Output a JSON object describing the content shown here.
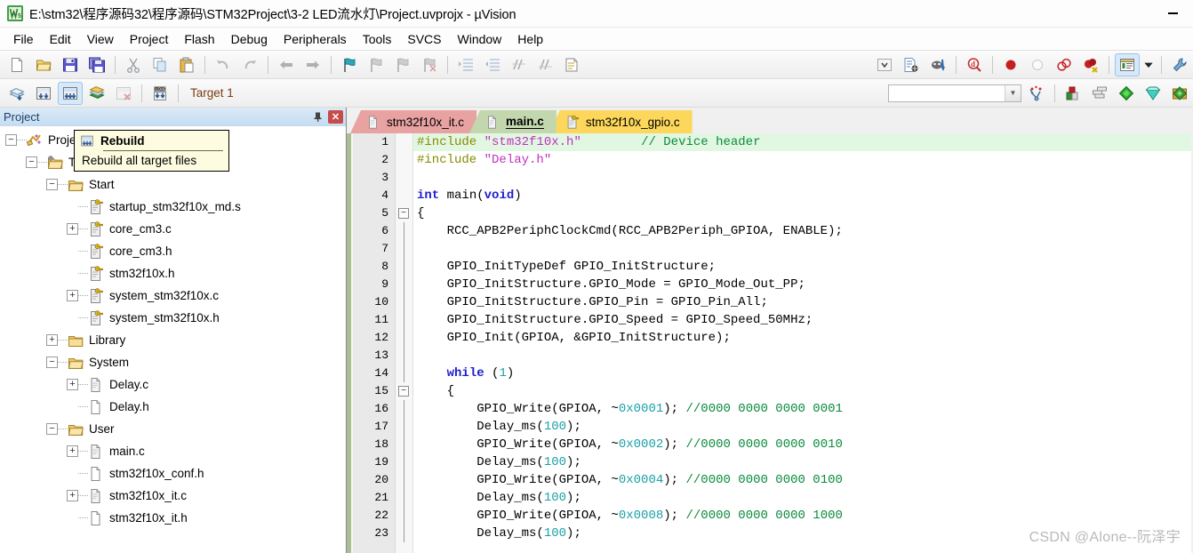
{
  "window": {
    "title": "E:\\stm32\\程序源码32\\程序源码\\STM32Project\\3-2 LED流水灯\\Project.uvprojx - µVision",
    "logo_text": "µV",
    "minimize_label": "—"
  },
  "menu": {
    "items": [
      "File",
      "Edit",
      "View",
      "Project",
      "Flash",
      "Debug",
      "Peripherals",
      "Tools",
      "SVCS",
      "Window",
      "Help"
    ]
  },
  "toolbar_main": {
    "icons": [
      "new-file-icon",
      "open-file-icon",
      "save-icon",
      "save-all-icon",
      "cut-icon",
      "copy-icon",
      "paste-icon",
      "undo-icon",
      "redo-icon",
      "navigate-back-icon",
      "navigate-forward-icon",
      "bookmark-toggle-icon",
      "bookmark-prev-icon",
      "bookmark-next-icon",
      "bookmark-clear-icon",
      "indent-icon",
      "outdent-icon",
      "comment-icon",
      "uncomment-icon",
      "find-in-files-icon"
    ],
    "right_icons": [
      "combo-arrow-icon",
      "configure-icon",
      "debug-settings-icon",
      "find-icon",
      "breakpoint-icon",
      "breakpoint-disable-icon",
      "breakpoint-disable-all-icon",
      "breakpoint-kill-all-icon",
      "project-window-icon",
      "dropdown-arrow-icon",
      "configure-target-icon"
    ]
  },
  "toolbar_build": {
    "icons": [
      "translate-icon",
      "build-icon",
      "rebuild-icon",
      "batch-build-icon",
      "stop-build-icon",
      "download-icon"
    ],
    "target_value": "Target 1",
    "right_icons": [
      "manage-project-items-icon",
      "multi-project-icon",
      "start-debug-icon",
      "insert-icon",
      "manage-components-icon"
    ]
  },
  "project_panel": {
    "title": "Project",
    "pin_icon": "pin-icon",
    "close_label": "✕",
    "tree": [
      {
        "level": 0,
        "expander": "minus",
        "icon": "project-icon",
        "label": "Project: Project"
      },
      {
        "level": 1,
        "expander": "minus",
        "icon": "target-folder-icon",
        "label": "Target 1"
      },
      {
        "level": 2,
        "expander": "minus",
        "icon": "folder-open-icon",
        "label": "Start"
      },
      {
        "level": 3,
        "expander": "none",
        "icon": "source-key-icon",
        "label": "startup_stm32f10x_md.s"
      },
      {
        "level": 3,
        "expander": "plus",
        "icon": "source-key-icon",
        "label": "core_cm3.c"
      },
      {
        "level": 3,
        "expander": "none",
        "icon": "source-key-icon",
        "label": "core_cm3.h"
      },
      {
        "level": 3,
        "expander": "none",
        "icon": "source-key-icon",
        "label": "stm32f10x.h"
      },
      {
        "level": 3,
        "expander": "plus",
        "icon": "source-key-icon",
        "label": "system_stm32f10x.c"
      },
      {
        "level": 3,
        "expander": "none",
        "icon": "source-key-icon",
        "label": "system_stm32f10x.h"
      },
      {
        "level": 2,
        "expander": "plus",
        "icon": "folder-icon",
        "label": "Library"
      },
      {
        "level": 2,
        "expander": "minus",
        "icon": "folder-open-icon",
        "label": "System"
      },
      {
        "level": 3,
        "expander": "plus",
        "icon": "source-file-icon",
        "label": "Delay.c"
      },
      {
        "level": 3,
        "expander": "none",
        "icon": "header-file-icon",
        "label": "Delay.h"
      },
      {
        "level": 2,
        "expander": "minus",
        "icon": "folder-open-icon",
        "label": "User"
      },
      {
        "level": 3,
        "expander": "plus",
        "icon": "source-file-icon",
        "label": "main.c"
      },
      {
        "level": 3,
        "expander": "none",
        "icon": "header-file-icon",
        "label": "stm32f10x_conf.h"
      },
      {
        "level": 3,
        "expander": "plus",
        "icon": "source-file-icon",
        "label": "stm32f10x_it.c"
      },
      {
        "level": 3,
        "expander": "none",
        "icon": "header-file-icon",
        "label": "stm32f10x_it.h"
      }
    ]
  },
  "tooltip": {
    "icon": "rebuild-icon",
    "title": "Rebuild",
    "description": "Rebuild all target files"
  },
  "editor": {
    "tabs": [
      {
        "label": "stm32f10x_it.c",
        "color": "pink",
        "icon": "source-file-icon",
        "active": false
      },
      {
        "label": "main.c",
        "color": "green",
        "icon": "source-file-icon",
        "active": true
      },
      {
        "label": "stm32f10x_gpio.c",
        "color": "yellow",
        "icon": "source-key-icon",
        "active": false
      }
    ],
    "lines": [
      {
        "n": 1,
        "fold": "",
        "hl": true,
        "tokens": [
          [
            "pre",
            "#include"
          ],
          [
            "txt",
            " "
          ],
          [
            "str",
            "\"stm32f10x.h\""
          ],
          [
            "txt",
            "\t\t"
          ],
          [
            "cmt",
            "// Device header"
          ]
        ]
      },
      {
        "n": 2,
        "fold": "",
        "hl": false,
        "tokens": [
          [
            "pre",
            "#include"
          ],
          [
            "txt",
            " "
          ],
          [
            "str",
            "\"Delay.h\""
          ]
        ]
      },
      {
        "n": 3,
        "fold": "",
        "hl": false,
        "tokens": []
      },
      {
        "n": 4,
        "fold": "",
        "hl": false,
        "tokens": [
          [
            "kw",
            "int"
          ],
          [
            "txt",
            " main("
          ],
          [
            "kw",
            "void"
          ],
          [
            "txt",
            ")"
          ]
        ]
      },
      {
        "n": 5,
        "fold": "minus",
        "hl": false,
        "tokens": [
          [
            "txt",
            "{"
          ]
        ]
      },
      {
        "n": 6,
        "fold": "bar",
        "hl": false,
        "tokens": [
          [
            "txt",
            "\tRCC_APB2PeriphClockCmd(RCC_APB2Periph_GPIOA, ENABLE);"
          ]
        ]
      },
      {
        "n": 7,
        "fold": "bar",
        "hl": false,
        "tokens": []
      },
      {
        "n": 8,
        "fold": "bar",
        "hl": false,
        "tokens": [
          [
            "txt",
            "\tGPIO_InitTypeDef GPIO_InitStructure;"
          ]
        ]
      },
      {
        "n": 9,
        "fold": "bar",
        "hl": false,
        "tokens": [
          [
            "txt",
            "\tGPIO_InitStructure.GPIO_Mode = GPIO_Mode_Out_PP;"
          ]
        ]
      },
      {
        "n": 10,
        "fold": "bar",
        "hl": false,
        "tokens": [
          [
            "txt",
            "\tGPIO_InitStructure.GPIO_Pin = GPIO_Pin_All;"
          ]
        ]
      },
      {
        "n": 11,
        "fold": "bar",
        "hl": false,
        "tokens": [
          [
            "txt",
            "\tGPIO_InitStructure.GPIO_Speed = GPIO_Speed_50MHz;"
          ]
        ]
      },
      {
        "n": 12,
        "fold": "bar",
        "hl": false,
        "tokens": [
          [
            "txt",
            "\tGPIO_Init(GPIOA, &GPIO_InitStructure);"
          ]
        ]
      },
      {
        "n": 13,
        "fold": "bar",
        "hl": false,
        "tokens": []
      },
      {
        "n": 14,
        "fold": "bar",
        "hl": false,
        "tokens": [
          [
            "txt",
            "\t"
          ],
          [
            "kw",
            "while"
          ],
          [
            "txt",
            " ("
          ],
          [
            "num",
            "1"
          ],
          [
            "txt",
            ")"
          ]
        ]
      },
      {
        "n": 15,
        "fold": "minus2",
        "hl": false,
        "tokens": [
          [
            "txt",
            "\t{"
          ]
        ]
      },
      {
        "n": 16,
        "fold": "bar2",
        "hl": false,
        "tokens": [
          [
            "txt",
            "\t\tGPIO_Write(GPIOA, ~"
          ],
          [
            "num",
            "0x0001"
          ],
          [
            "txt",
            "); "
          ],
          [
            "cmt",
            "//0000 0000 0000 0001"
          ]
        ]
      },
      {
        "n": 17,
        "fold": "bar2",
        "hl": false,
        "tokens": [
          [
            "txt",
            "\t\tDelay_ms("
          ],
          [
            "num",
            "100"
          ],
          [
            "txt",
            ");"
          ]
        ]
      },
      {
        "n": 18,
        "fold": "bar2",
        "hl": false,
        "tokens": [
          [
            "txt",
            "\t\tGPIO_Write(GPIOA, ~"
          ],
          [
            "num",
            "0x0002"
          ],
          [
            "txt",
            "); "
          ],
          [
            "cmt",
            "//0000 0000 0000 0010"
          ]
        ]
      },
      {
        "n": 19,
        "fold": "bar2",
        "hl": false,
        "tokens": [
          [
            "txt",
            "\t\tDelay_ms("
          ],
          [
            "num",
            "100"
          ],
          [
            "txt",
            ");"
          ]
        ]
      },
      {
        "n": 20,
        "fold": "bar2",
        "hl": false,
        "tokens": [
          [
            "txt",
            "\t\tGPIO_Write(GPIOA, ~"
          ],
          [
            "num",
            "0x0004"
          ],
          [
            "txt",
            "); "
          ],
          [
            "cmt",
            "//0000 0000 0000 0100"
          ]
        ]
      },
      {
        "n": 21,
        "fold": "bar2",
        "hl": false,
        "tokens": [
          [
            "txt",
            "\t\tDelay_ms("
          ],
          [
            "num",
            "100"
          ],
          [
            "txt",
            ");"
          ]
        ]
      },
      {
        "n": 22,
        "fold": "bar2",
        "hl": false,
        "tokens": [
          [
            "txt",
            "\t\tGPIO_Write(GPIOA, ~"
          ],
          [
            "num",
            "0x0008"
          ],
          [
            "txt",
            "); "
          ],
          [
            "cmt",
            "//0000 0000 0000 1000"
          ]
        ]
      },
      {
        "n": 23,
        "fold": "bar2",
        "hl": false,
        "tokens": [
          [
            "txt",
            "\t\tDelay_ms("
          ],
          [
            "num",
            "100"
          ],
          [
            "txt",
            ");"
          ]
        ]
      }
    ]
  },
  "watermark": {
    "text": "CSDN @Alone--阮泽宇"
  },
  "colors": {
    "accent_tab_active": "#c3d7ae",
    "accent_tab_modified": "#e8a2a2",
    "accent_tab_readonly": "#fcd75b",
    "comment": "#0a8a3c",
    "string": "#c030c0",
    "preprocessor": "#8a8a00",
    "keyword": "#2020d0",
    "number": "#1ba0a8",
    "highlight_line": "#e2f7e2",
    "panel_header": "#cfe3f5",
    "close_button": "#c84b4b"
  }
}
